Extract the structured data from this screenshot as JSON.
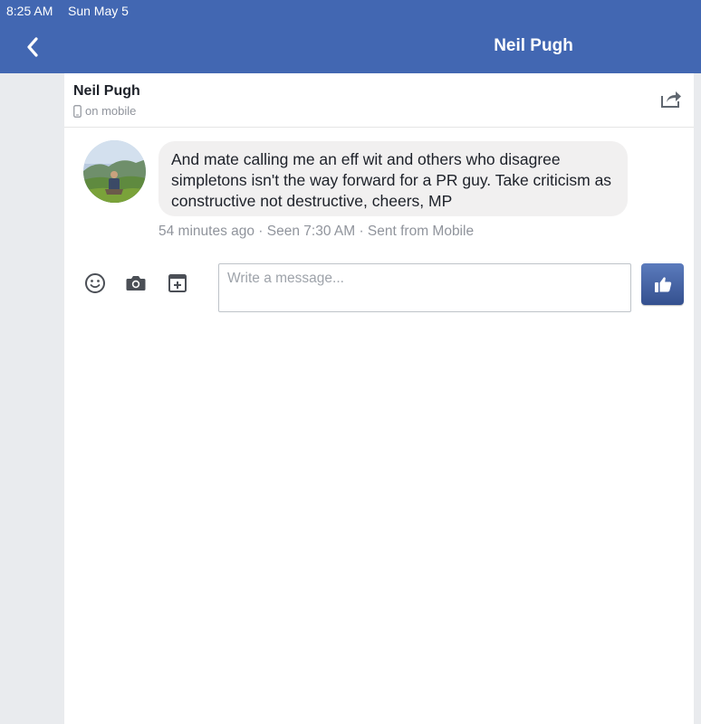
{
  "status_bar": {
    "time": "8:25 AM",
    "date": "Sun May 5"
  },
  "nav": {
    "title": "Neil Pugh",
    "back_icon": "chevron-left-icon"
  },
  "conversation": {
    "contact_name": "Neil Pugh",
    "presence": "on mobile",
    "share_icon": "share-icon"
  },
  "message": {
    "text": "And mate calling me an eff wit and others who disagree simpletons isn't the way forward for a PR guy. Take criticism as constructive not destructive, cheers, MP",
    "meta": "54 minutes ago · Seen 7:30 AM · Sent from Mobile"
  },
  "composer": {
    "placeholder": "Write a message...",
    "value": "",
    "icons": [
      "smiley-icon",
      "camera-icon",
      "sticker-icon",
      "thumbs-up-icon"
    ]
  },
  "colors": {
    "brand": "#4267b2",
    "bubble": "#f1f0f0",
    "muted_text": "#90949c"
  }
}
